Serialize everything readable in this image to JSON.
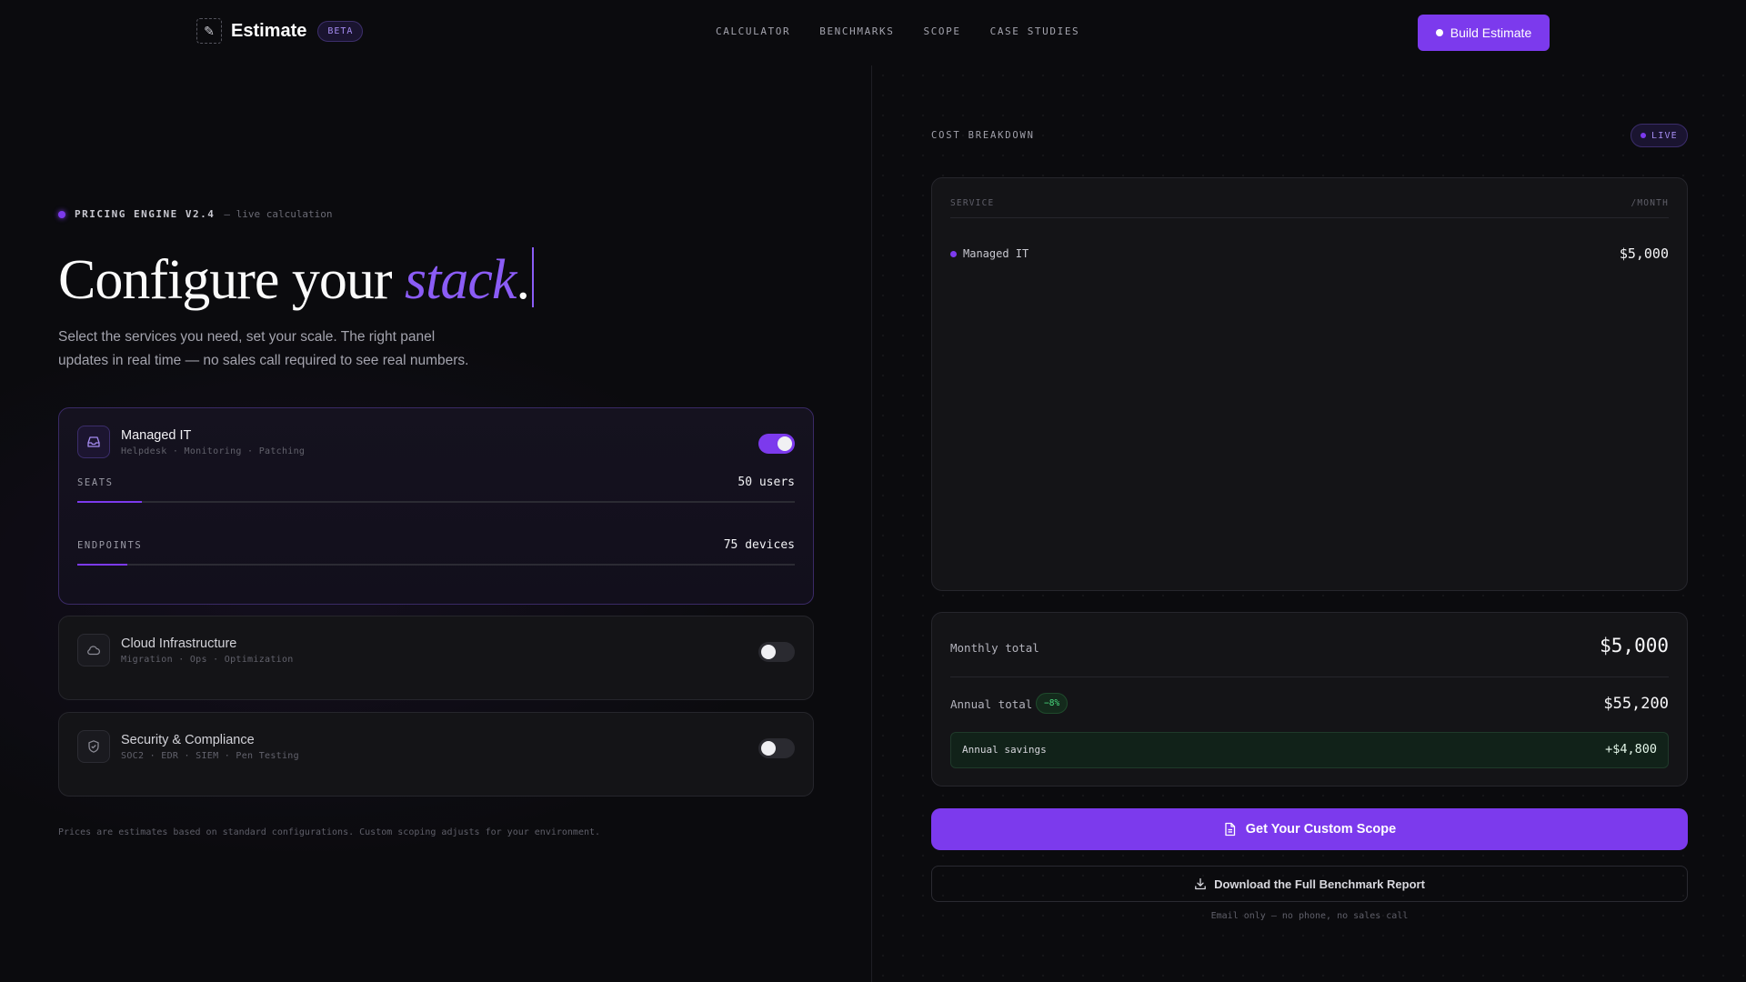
{
  "header": {
    "logo_text": "Estimate",
    "beta_label": "BETA",
    "nav": [
      "CALCULATOR",
      "BENCHMARKS",
      "SCOPE",
      "CASE STUDIES"
    ],
    "cta_label": "Build Estimate"
  },
  "hero": {
    "engine_label": "PRICING ENGINE V2.4",
    "engine_sub": "— live calculation",
    "title_prefix": "Configure your ",
    "title_accent": "stack",
    "title_suffix": ".",
    "subtitle": "Select the services you need, set your scale. The right panel updates in real time — no sales call required to see real numbers."
  },
  "services": [
    {
      "title": "Managed IT",
      "tags": "Helpdesk · Monitoring · Patching",
      "icon": "inbox-icon",
      "enabled": true,
      "sliders": [
        {
          "label": "SEATS",
          "value": "50 users",
          "fraction": 0.09
        },
        {
          "label": "ENDPOINTS",
          "value": "75 devices",
          "fraction": 0.07
        }
      ]
    },
    {
      "title": "Cloud Infrastructure",
      "tags": "Migration · Ops · Optimization",
      "icon": "cloud-icon",
      "enabled": false
    },
    {
      "title": "Security & Compliance",
      "tags": "SOC2 · EDR · SIEM · Pen Testing",
      "icon": "shield-icon",
      "enabled": false
    }
  ],
  "footnote": "Prices are estimates based on standard configurations. Custom scoping adjusts for your environment.",
  "breakdown": {
    "label": "COST BREAKDOWN",
    "live_label": "LIVE",
    "col_service": "SERVICE",
    "col_month": "/MONTH",
    "rows": [
      {
        "name": "Managed IT",
        "value": "$5,000"
      }
    ]
  },
  "totals": {
    "monthly_label": "Monthly total",
    "monthly_value": "$5,000",
    "annual_label": "Annual total",
    "discount": "−8%",
    "annual_value": "$55,200",
    "savings_label": "Annual savings",
    "savings_value": "+$4,800"
  },
  "actions": {
    "scope_label": "Get Your Custom Scope",
    "download_label": "Download the Full Benchmark Report",
    "email_note": "Email only — no phone, no sales call"
  },
  "colors": {
    "accent": "#7c3aed",
    "background": "#0b0b0e",
    "success": "#4ade80"
  }
}
